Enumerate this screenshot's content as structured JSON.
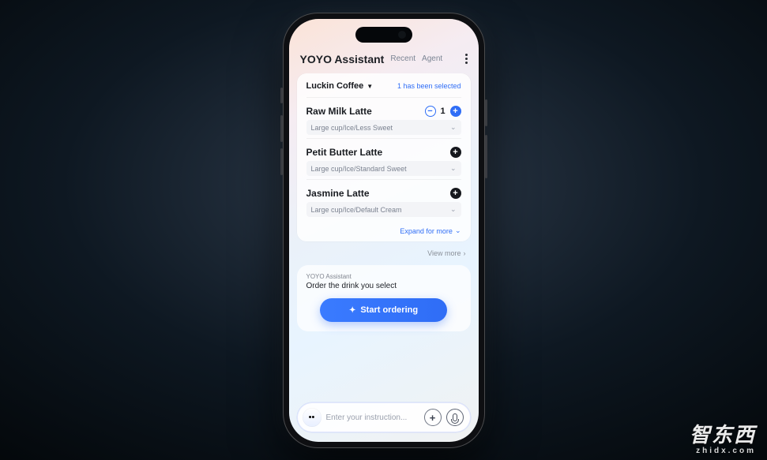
{
  "watermark": {
    "line1": "智东西",
    "line2": "zhidx.com"
  },
  "header": {
    "title": "YOYO Assistant",
    "tabs": [
      "Recent",
      "Agent"
    ]
  },
  "store_card": {
    "store_name": "Luckin Coffee",
    "selected_text": "1 has been selected",
    "items": [
      {
        "name": "Raw Milk Latte",
        "qty": "1",
        "spec": "Large cup/Ice/Less Sweet",
        "has_qty": true
      },
      {
        "name": "Petit Butter Latte",
        "spec": "Large cup/Ice/Standard Sweet",
        "has_qty": false
      },
      {
        "name": "Jasmine Latte",
        "spec": "Large cup/Ice/Default Cream",
        "has_qty": false
      }
    ],
    "expand_label": "Expand for more",
    "view_more_label": "View more"
  },
  "assistant": {
    "from": "YOYO Assistant",
    "message": "Order the drink you select",
    "cta": "Start ordering"
  },
  "input": {
    "placeholder": "Enter your instruction..."
  }
}
